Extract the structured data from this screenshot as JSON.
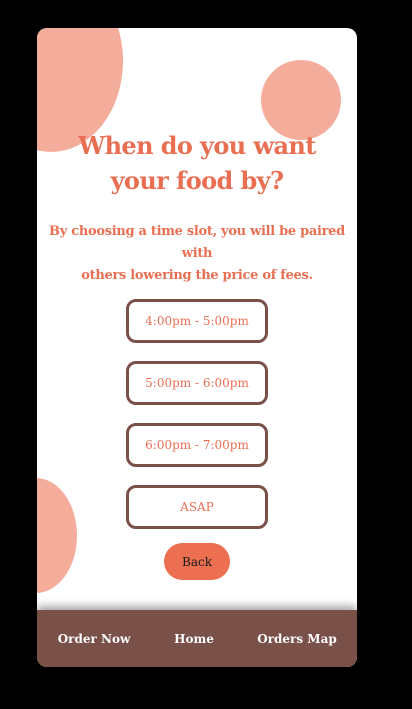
{
  "colors": {
    "background": "#000000",
    "card": "#ffffff",
    "accent": "#e86f52",
    "blob": "#f4ad9b",
    "button_border": "#7a5148",
    "navbar": "#7a5148",
    "back_button": "#ec6f52"
  },
  "header": {
    "title_line1": "When do you want",
    "title_line2": "your food by?",
    "subtitle_line1": "By choosing a time slot, you will be paired with",
    "subtitle_line2": "others lowering the price of fees."
  },
  "time_slots": [
    {
      "label": "4:00pm - 5:00pm"
    },
    {
      "label": "5:00pm - 6:00pm"
    },
    {
      "label": "6:00pm - 7:00pm"
    },
    {
      "label": "ASAP"
    }
  ],
  "back_label": "Back",
  "navbar": {
    "items": [
      {
        "label": "Order Now"
      },
      {
        "label": "Home"
      },
      {
        "label": "Orders Map"
      }
    ]
  }
}
